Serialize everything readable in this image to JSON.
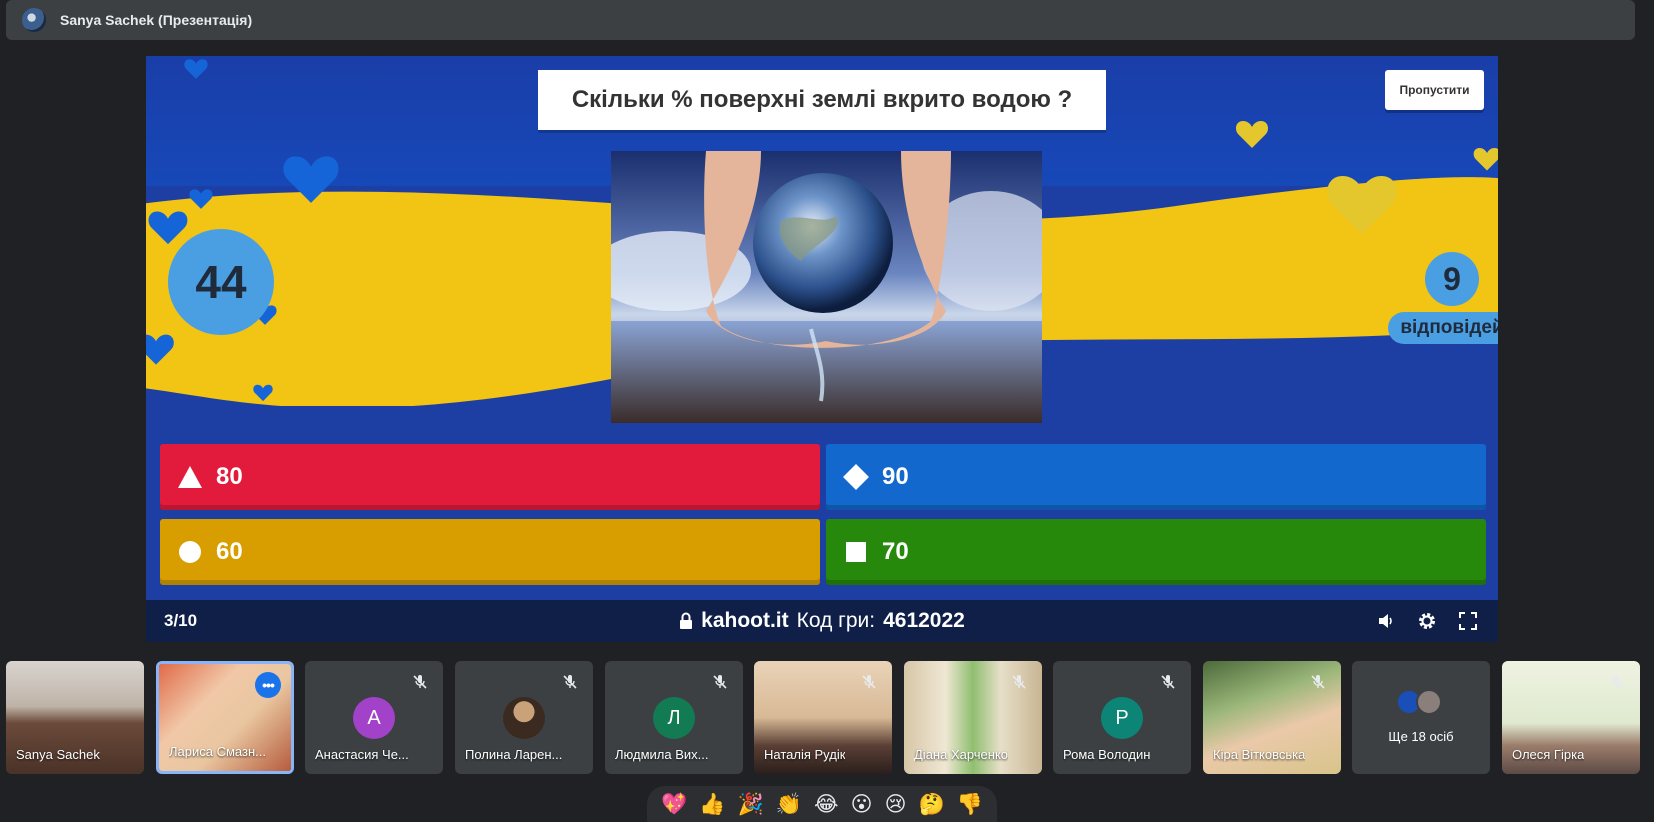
{
  "header": {
    "title": "Sanya Sachek (Презентація)"
  },
  "quiz": {
    "question": "Скільки % поверхні землі вкрито водою ?",
    "skip_label": "Пропустити",
    "timer": "44",
    "answers_count": "9",
    "answers_label": "відповідей",
    "answers": [
      {
        "shape": "triangle-icon",
        "value": "80",
        "color": "#e21b3c"
      },
      {
        "shape": "diamond-icon",
        "value": "90",
        "color": "#1368ce"
      },
      {
        "shape": "circle-icon",
        "value": "60",
        "color": "#d89e00"
      },
      {
        "shape": "square-icon",
        "value": "70",
        "color": "#26890c"
      }
    ],
    "progress": "3/10",
    "site": "kahoot.it",
    "code_label": "Код гри:",
    "code": "4612022"
  },
  "participants": [
    {
      "name": "Sanya Sachek",
      "type": "video"
    },
    {
      "name": "Лариса Смазн...",
      "type": "video",
      "active": true
    },
    {
      "name": "Анастасия Че...",
      "initial": "А",
      "avatar_color": "#a142c9",
      "muted": true
    },
    {
      "name": "Полина Ларен...",
      "type": "photo",
      "muted": true
    },
    {
      "name": "Людмила Вих...",
      "initial": "Л",
      "avatar_color": "#127b53",
      "muted": true
    },
    {
      "name": "Наталія Рудік",
      "type": "video",
      "muted": true
    },
    {
      "name": "Діана Харченко",
      "type": "video",
      "muted": true
    },
    {
      "name": "Рома Володин",
      "initial": "Р",
      "avatar_color": "#0c8577",
      "muted": true
    },
    {
      "name": "Кіра Вітковська",
      "type": "video",
      "muted": true
    },
    {
      "name": "Ще 18 осіб",
      "type": "more"
    },
    {
      "name": "Олеся Гірка",
      "type": "video",
      "muted": true
    }
  ],
  "reactions": [
    "💖",
    "👍",
    "🎉",
    "👏",
    "😂",
    "😮",
    "😢",
    "🤔",
    "👎"
  ]
}
